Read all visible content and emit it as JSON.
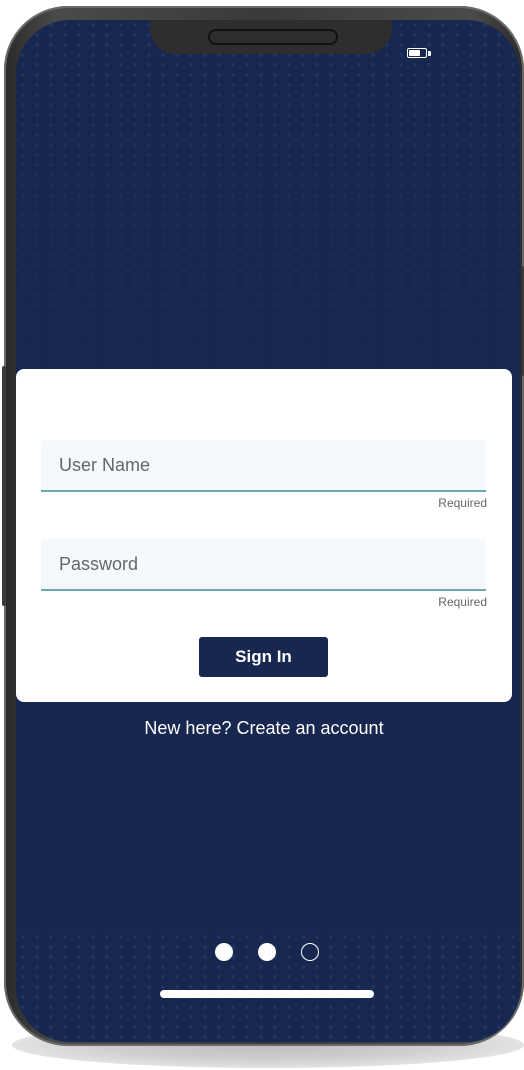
{
  "status_bar": {
    "battery_icon": "battery-icon",
    "battery_level": 0.6
  },
  "login_form": {
    "username": {
      "placeholder": "User Name",
      "value": "",
      "hint": "Required"
    },
    "password": {
      "placeholder": "Password",
      "value": "",
      "hint": "Required"
    },
    "sign_in_label": "Sign In"
  },
  "create_account_text": "New here? Create an account",
  "pagination": {
    "total": 3,
    "states": [
      "filled",
      "filled",
      "empty"
    ]
  },
  "colors": {
    "background": "#17274f",
    "card": "#ffffff",
    "field_underline": "#6aa9b6",
    "button": "#17274f"
  }
}
